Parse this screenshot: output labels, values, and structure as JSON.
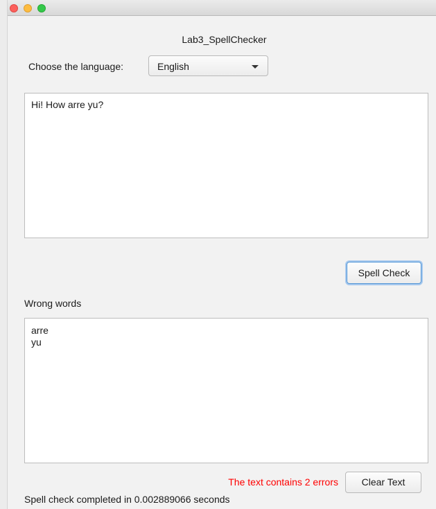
{
  "app": {
    "title": "Lab3_SpellChecker"
  },
  "language": {
    "label": "Choose the language:",
    "selected": "English"
  },
  "input": {
    "value": "Hi! How arre yu?"
  },
  "actions": {
    "spell_check_label": "Spell Check",
    "clear_label": "Clear Text"
  },
  "results": {
    "label": "Wrong words",
    "value": "arre\nyu",
    "error_status": "The text contains 2 errors",
    "timing": "Spell check completed in 0.002889066 seconds"
  },
  "colors": {
    "error_text": "#ff0000",
    "focus_ring": "#4f94d6"
  }
}
